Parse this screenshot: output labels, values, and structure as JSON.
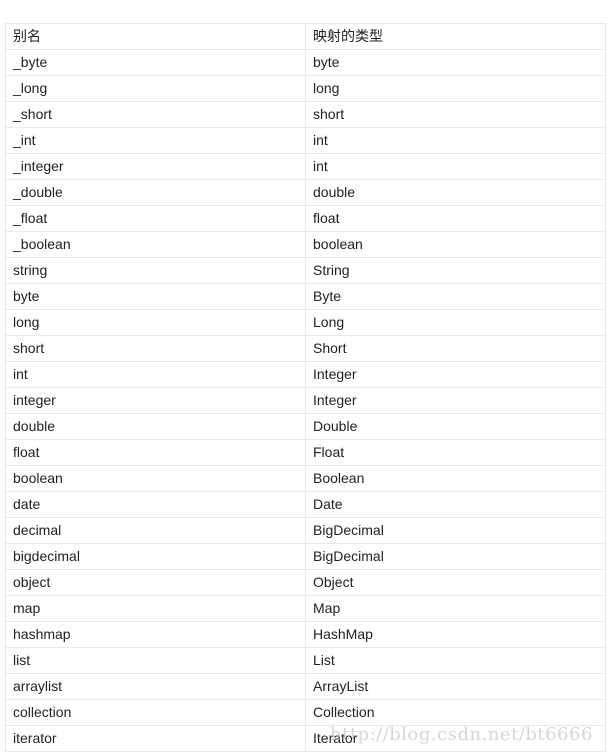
{
  "table": {
    "headers": [
      "别名",
      "映射的类型"
    ],
    "rows": [
      [
        "_byte",
        "byte"
      ],
      [
        "_long",
        "long"
      ],
      [
        "_short",
        "short"
      ],
      [
        "_int",
        "int"
      ],
      [
        "_integer",
        "int"
      ],
      [
        "_double",
        "double"
      ],
      [
        "_float",
        "float"
      ],
      [
        "_boolean",
        "boolean"
      ],
      [
        "string",
        "String"
      ],
      [
        "byte",
        "Byte"
      ],
      [
        "long",
        "Long"
      ],
      [
        "short",
        "Short"
      ],
      [
        "int",
        "Integer"
      ],
      [
        "integer",
        "Integer"
      ],
      [
        "double",
        "Double"
      ],
      [
        "float",
        "Float"
      ],
      [
        "boolean",
        "Boolean"
      ],
      [
        "date",
        "Date"
      ],
      [
        "decimal",
        "BigDecimal"
      ],
      [
        "bigdecimal",
        "BigDecimal"
      ],
      [
        "object",
        "Object"
      ],
      [
        "map",
        "Map"
      ],
      [
        "hashmap",
        "HashMap"
      ],
      [
        "list",
        "List"
      ],
      [
        "arraylist",
        "ArrayList"
      ],
      [
        "collection",
        "Collection"
      ],
      [
        "iterator",
        "Iterator"
      ]
    ]
  },
  "watermark": "http://blog.csdn.net/bt6666"
}
